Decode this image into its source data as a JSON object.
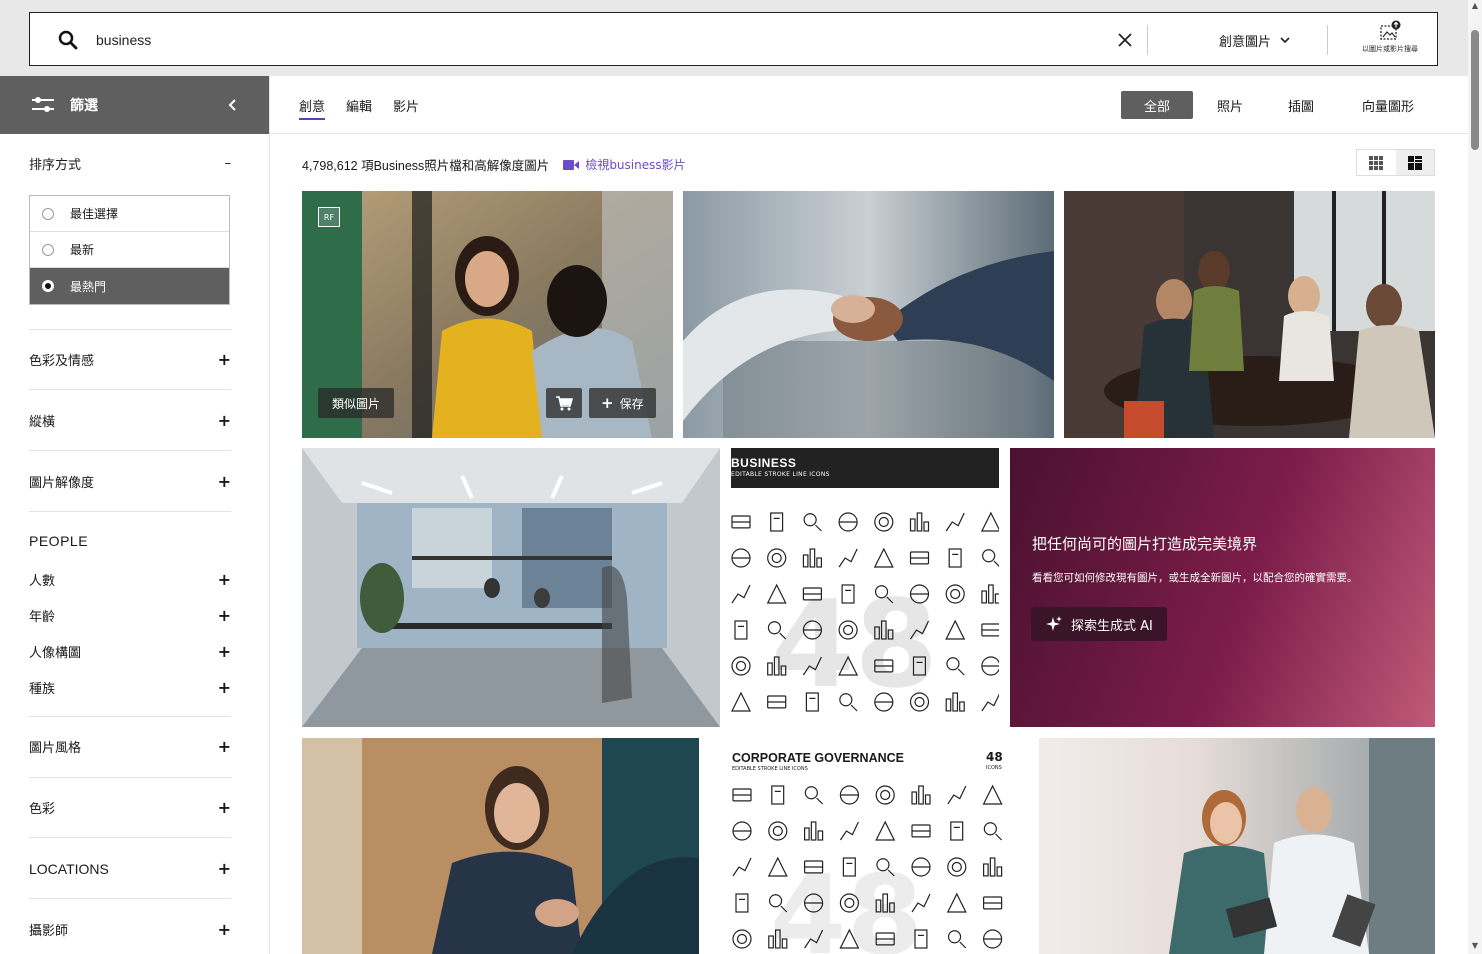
{
  "search": {
    "value": "business",
    "type_select": "創意圖片",
    "image_search_label": "以圖片或影片搜尋"
  },
  "sidebar": {
    "filter_label": "篩選",
    "sort_title": "排序方式",
    "sort_options": [
      "最佳選擇",
      "最新",
      "最熱門"
    ],
    "sort_selected": "最熱門",
    "sections": {
      "color_mood": "色彩及情感",
      "orientation": "縱橫",
      "resolution": "圖片解像度",
      "people_header": "PEOPLE",
      "people_count": "人數",
      "age": "年齡",
      "composition": "人像構圖",
      "ethnicity": "種族",
      "image_style": "圖片風格",
      "color": "色彩",
      "locations": "LOCATIONS",
      "photographer": "攝影師"
    },
    "plus": "+",
    "minus": "–"
  },
  "content_tabs": [
    "創意",
    "編輯",
    "影片"
  ],
  "asset_tabs": [
    "全部",
    "照片",
    "插圖",
    "向量圖形"
  ],
  "results": {
    "count_text": "4,798,612 項Business照片檔和高解像度圖片",
    "video_link": "檢視business影片"
  },
  "tile_actions": {
    "rf": "RF",
    "similar": "類似圖片",
    "save": "保存"
  },
  "icon_set_1": {
    "title": "BUSINESS",
    "subtitle": "EDITABLE STROKE LINE ICONS"
  },
  "icon_set_2": {
    "title": "CORPORATE GOVERNANCE",
    "subtitle": "EDITABLE STROKE LINE ICONS",
    "count": "48",
    "count_label": "ICONS"
  },
  "promo": {
    "title": "把任何尚可的圖片打造成完美境界",
    "subtitle": "看看您可如何修改現有圖片，或生成全新圖片，以配合您的確實需要。",
    "button": "探索生成式 AI"
  },
  "colors": {
    "accent": "#5b3fbf",
    "dark_gray": "#5f5f5f",
    "promo_start": "#4a1130",
    "promo_end": "#c05a78"
  }
}
